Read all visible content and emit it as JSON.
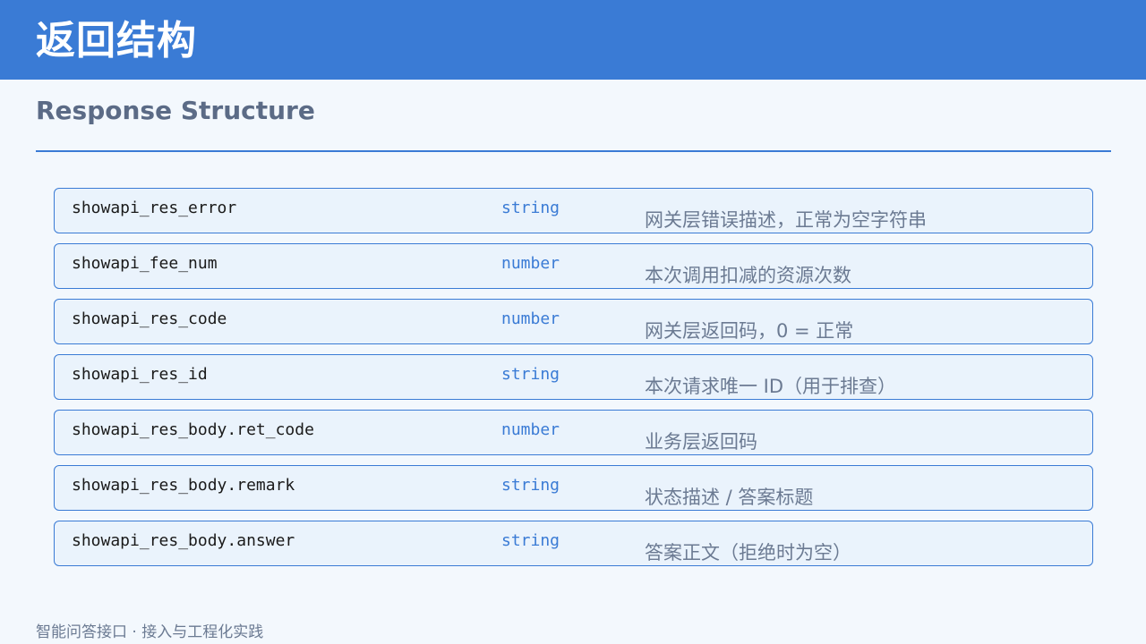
{
  "header": {
    "title": "返回结构",
    "subtitle": "Response Structure"
  },
  "colors": {
    "accent": "#3a7bd5",
    "row_background": "#eaf3fc",
    "page_background": "#f3f8fd"
  },
  "fields": [
    {
      "name": "showapi_res_error",
      "type": "string",
      "description": "网关层错误描述，正常为空字符串"
    },
    {
      "name": "showapi_fee_num",
      "type": "number",
      "description": "本次调用扣减的资源次数"
    },
    {
      "name": "showapi_res_code",
      "type": "number",
      "description": "网关层返回码，0 = 正常"
    },
    {
      "name": "showapi_res_id",
      "type": "string",
      "description": "本次请求唯一 ID（用于排查）"
    },
    {
      "name": "showapi_res_body.ret_code",
      "type": "number",
      "description": "业务层返回码"
    },
    {
      "name": "showapi_res_body.remark",
      "type": "string",
      "description": "状态描述 / 答案标题"
    },
    {
      "name": "showapi_res_body.answer",
      "type": "string",
      "description": "答案正文（拒绝时为空）"
    }
  ],
  "footer": {
    "text": "智能问答接口 · 接入与工程化实践"
  }
}
